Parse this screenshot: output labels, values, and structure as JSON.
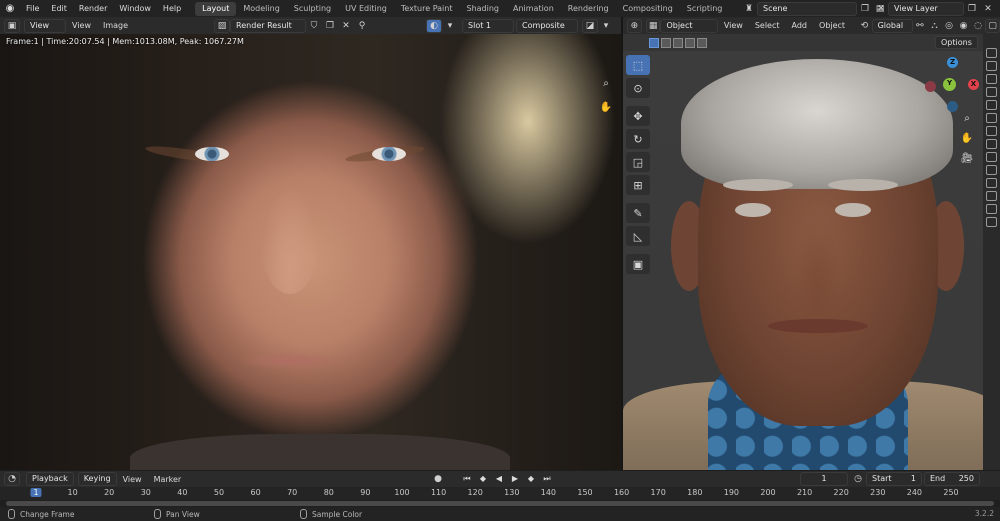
{
  "menu": {
    "items": [
      "File",
      "Edit",
      "Render",
      "Window",
      "Help"
    ]
  },
  "workspaces": {
    "tabs": [
      "Layout",
      "Modeling",
      "Sculpting",
      "UV Editing",
      "Texture Paint",
      "Shading",
      "Animation",
      "Rendering",
      "Compositing",
      "Scripting"
    ],
    "active_index": 0
  },
  "scene": {
    "name": "Scene"
  },
  "view_layer": {
    "name": "View Layer"
  },
  "image_editor": {
    "view_label": "View",
    "menu_view": "View",
    "menu_image": "Image",
    "image_name": "Render Result",
    "slot": "Slot 1",
    "layer": "Composite",
    "frame_info": "Frame:1 | Time:20:07.54 | Mem:1013.08M, Peak: 1067.27M"
  },
  "viewport": {
    "mode": "Object Mode",
    "menu": [
      "View",
      "Select",
      "Add",
      "Object"
    ],
    "orientation": "Global",
    "options_label": "Options",
    "gizmo": {
      "z": "Z",
      "x": "X",
      "y": "Y"
    }
  },
  "timeline": {
    "menu": [
      "Playback",
      "Keying",
      "View",
      "Marker"
    ],
    "current_frame": "1",
    "start_label": "Start",
    "start_value": "1",
    "end_label": "End",
    "end_value": "250",
    "ticks": [
      "1",
      "10",
      "20",
      "30",
      "40",
      "50",
      "60",
      "70",
      "80",
      "90",
      "100",
      "110",
      "120",
      "130",
      "140",
      "150",
      "160",
      "170",
      "180",
      "190",
      "200",
      "210",
      "220",
      "230",
      "240",
      "250"
    ]
  },
  "status": {
    "left": "Change Frame",
    "middle": "Pan View",
    "right": "Sample Color",
    "version": "3.2.2"
  },
  "colors": {
    "accent": "#4772b3",
    "x_axis": "#e2424c",
    "y_axis": "#8ac23e",
    "z_axis": "#3a8fd6"
  }
}
